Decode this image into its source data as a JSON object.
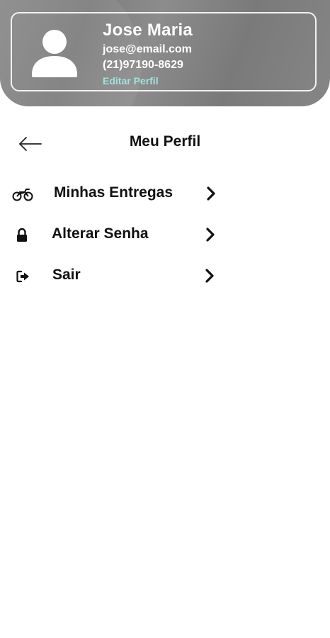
{
  "profile": {
    "name": "Jose Maria",
    "email": "jose@email.com",
    "phone": "(21)97190-8629",
    "edit_label": "Editar Perfil",
    "edit_color": "#9fe3dc",
    "avatar_icon": "user-avatar-icon"
  },
  "header": {
    "title": "Meu Perfil",
    "back_icon": "arrow-left-icon"
  },
  "menu": {
    "items": [
      {
        "label": "Minhas Entregas",
        "icon": "motorcycle-icon"
      },
      {
        "label": "Alterar Senha",
        "icon": "lock-icon"
      },
      {
        "label": "Sair",
        "icon": "sign-out-icon"
      }
    ]
  }
}
